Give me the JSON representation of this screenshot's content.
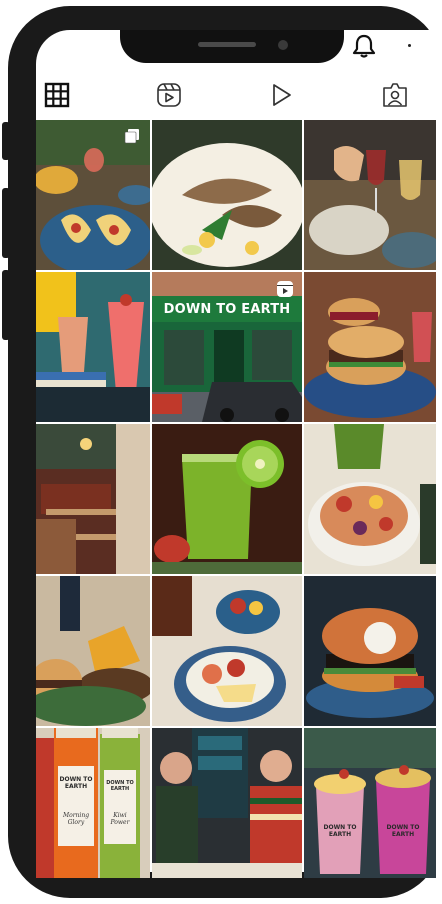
{
  "tabs": [
    {
      "name": "posts-grid-icon",
      "active": true
    },
    {
      "name": "reels-icon",
      "active": false
    },
    {
      "name": "videos-icon",
      "active": false
    },
    {
      "name": "tagged-icon",
      "active": false
    }
  ],
  "posts": [
    {
      "id": "tacos",
      "badge": "multi-photo-icon"
    },
    {
      "id": "grilled-fish"
    },
    {
      "id": "wine-toast"
    },
    {
      "id": "pink-drinks"
    },
    {
      "id": "storefront",
      "badge": "reel-icon",
      "sign": "DOWN TO EARTH"
    },
    {
      "id": "burger-stack"
    },
    {
      "id": "interior"
    },
    {
      "id": "kiwi-juice"
    },
    {
      "id": "acai-bowl"
    },
    {
      "id": "burger-fries"
    },
    {
      "id": "fruit-bowls"
    },
    {
      "id": "black-burger"
    },
    {
      "id": "juice-bottles",
      "labels": [
        "DOWN TO EARTH",
        "Morning Glory",
        "DOWN TO EARTH",
        "Kiwi Power"
      ]
    },
    {
      "id": "two-men"
    },
    {
      "id": "smoothies",
      "labels": [
        "DOWN TO EARTH",
        "DOWN TO EARTH"
      ]
    }
  ],
  "colors": {
    "accent": "#1a1a1a",
    "sign_green": "#1e7a3c"
  }
}
